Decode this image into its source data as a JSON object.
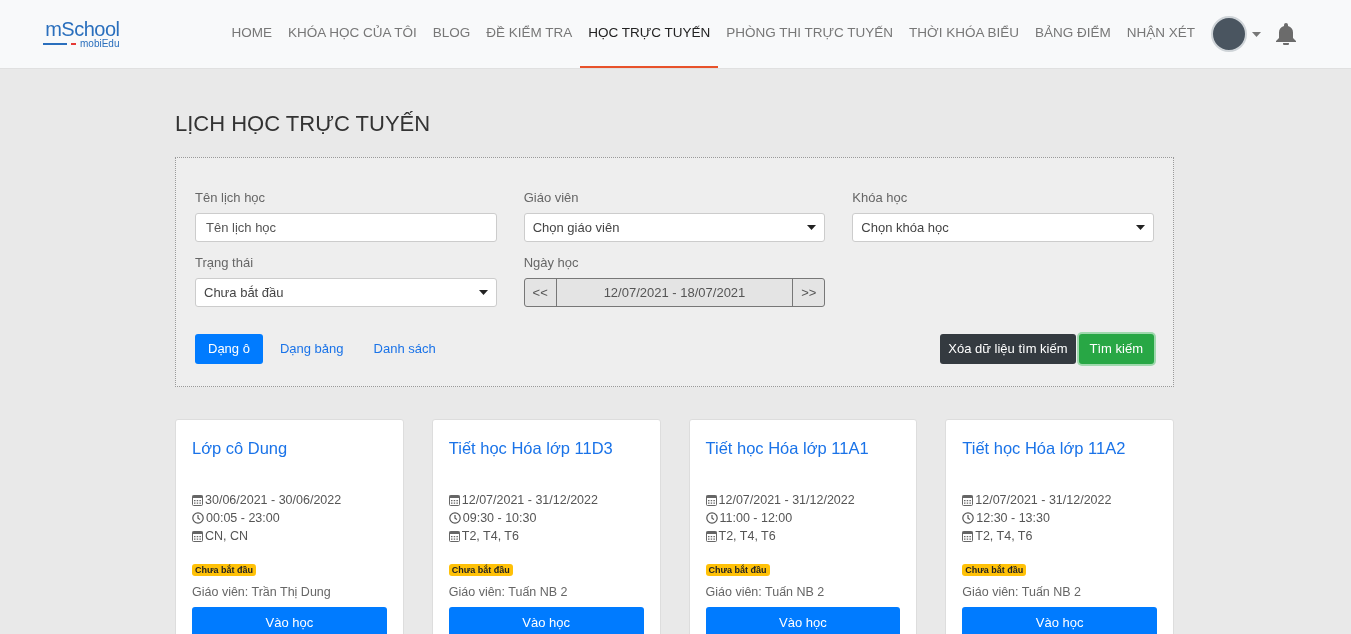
{
  "logo": {
    "title": "mSchool",
    "subtitle": "mobiEdu"
  },
  "nav": [
    {
      "label": "HOME",
      "selected": false
    },
    {
      "label": "KHÓA HỌC CỦA TÔI",
      "selected": false
    },
    {
      "label": "BLOG",
      "selected": false
    },
    {
      "label": "ĐỀ KIỂM TRA",
      "selected": false
    },
    {
      "label": "HỌC TRỰC TUYẾN",
      "selected": true
    },
    {
      "label": "PHÒNG THI TRỰC TUYẾN",
      "selected": false
    },
    {
      "label": "THỜI KHÓA BIỂU",
      "selected": false
    },
    {
      "label": "BẢNG ĐIỂM",
      "selected": false
    },
    {
      "label": "NHẬN XÉT",
      "selected": false
    }
  ],
  "page_title": "LỊCH HỌC TRỰC TUYẾN",
  "filters": [
    {
      "kind": "text",
      "label": "Tên lịch học",
      "placeholder": "Tên lịch học"
    },
    {
      "kind": "select",
      "label": "Giáo viên",
      "value": "Chọn giáo viên"
    },
    {
      "kind": "select",
      "label": "Khóa học",
      "value": "Chọn khóa học"
    },
    {
      "kind": "select",
      "label": "Trạng thái",
      "value": "Chưa bắt đầu"
    },
    {
      "kind": "daterange",
      "label": "Ngày học",
      "prev": "<<",
      "value": "12/07/2021 - 18/07/2021",
      "next": ">>"
    }
  ],
  "views": [
    {
      "label": "Dạng ô",
      "selected": true
    },
    {
      "label": "Dạng bảng",
      "selected": false
    },
    {
      "label": "Danh sách",
      "selected": false
    }
  ],
  "clear_button": "Xóa dữ liệu tìm kiếm",
  "search_button": "Tìm kiếm",
  "cards": [
    {
      "title": "Lớp cô Dung",
      "date_range": "30/06/2021 - 30/06/2022",
      "time": "00:05 - 23:00",
      "days": "CN, CN",
      "status": "Chưa bắt đầu",
      "teacher": "Giáo viên: Trần Thị Dung",
      "button": "Vào học"
    },
    {
      "title": "Tiết học Hóa lớp 11D3",
      "date_range": "12/07/2021 - 31/12/2022",
      "time": "09:30 - 10:30",
      "days": "T2, T4, T6",
      "status": "Chưa bắt đầu",
      "teacher": "Giáo viên: Tuấn NB 2",
      "button": "Vào học"
    },
    {
      "title": "Tiết học Hóa lớp 11A1",
      "date_range": "12/07/2021 - 31/12/2022",
      "time": "11:00 - 12:00",
      "days": "T2, T4, T6",
      "status": "Chưa bắt đầu",
      "teacher": "Giáo viên: Tuấn NB 2",
      "button": "Vào học"
    },
    {
      "title": "Tiết học Hóa lớp 11A2",
      "date_range": "12/07/2021 - 31/12/2022",
      "time": "12:30 - 13:30",
      "days": "T2, T4, T6",
      "status": "Chưa bắt đầu",
      "teacher": "Giáo viên: Tuấn NB 2",
      "button": "Vào học"
    }
  ]
}
